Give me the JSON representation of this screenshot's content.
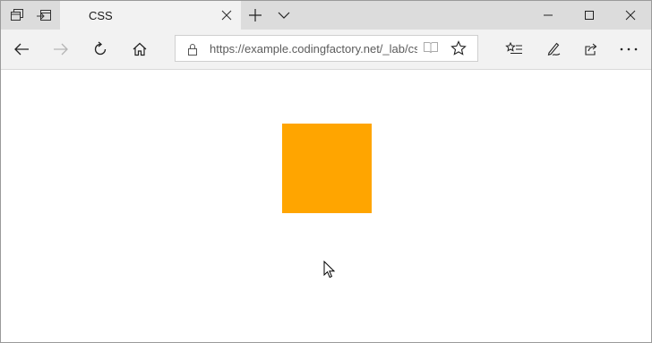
{
  "tab": {
    "title": "CSS"
  },
  "address_bar": {
    "url": "https://example.codingfactory.net/_lab/css"
  },
  "content": {
    "square_color": "#ffa500"
  },
  "icons": {
    "tab_actions": "tab-actions-icon",
    "set_aside": "set-aside-tabs-icon",
    "new_tab": "plus-icon",
    "tab_list": "chevron-down-icon",
    "minimize": "minimize-icon",
    "maximize": "maximize-icon",
    "close": "close-icon",
    "back": "back-arrow-icon",
    "forward": "forward-arrow-icon",
    "refresh": "refresh-icon",
    "home": "home-icon",
    "lock": "lock-icon",
    "reading_view": "book-icon",
    "favorite": "star-icon",
    "favorites_hub": "favorites-list-icon",
    "notes": "pen-icon",
    "share": "share-icon",
    "more": "more-icon"
  }
}
